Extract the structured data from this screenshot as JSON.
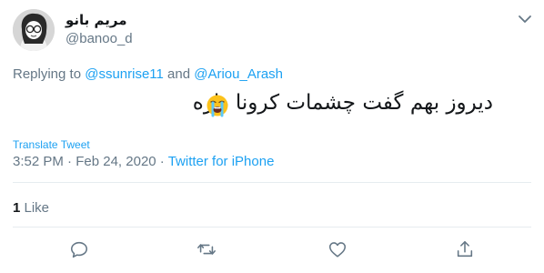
{
  "author": {
    "display_name": "مریم بانو",
    "handle": "@banoo_d"
  },
  "reply": {
    "prefix": "Replying to ",
    "user1": "@ssunrise11",
    "conjunction": " and ",
    "user2": "@Ariou_Arash"
  },
  "tweet": {
    "text": "دیروز بهم  گفت چشمات کرونا داره",
    "emoji": "loudly-crying-face-icon"
  },
  "translate_label": "Translate Tweet",
  "meta": {
    "time": "3:52 PM",
    "separator": " · ",
    "date": "Feb 24, 2020",
    "source": "Twitter for iPhone"
  },
  "likes": {
    "count": "1",
    "label": " Like"
  },
  "actions": [
    "reply-icon",
    "retweet-icon",
    "like-icon",
    "share-icon"
  ],
  "colors": {
    "accent": "#1da1f2",
    "secondary_text": "#657786",
    "primary_text": "#14171a",
    "divider": "#e6ecf0"
  }
}
